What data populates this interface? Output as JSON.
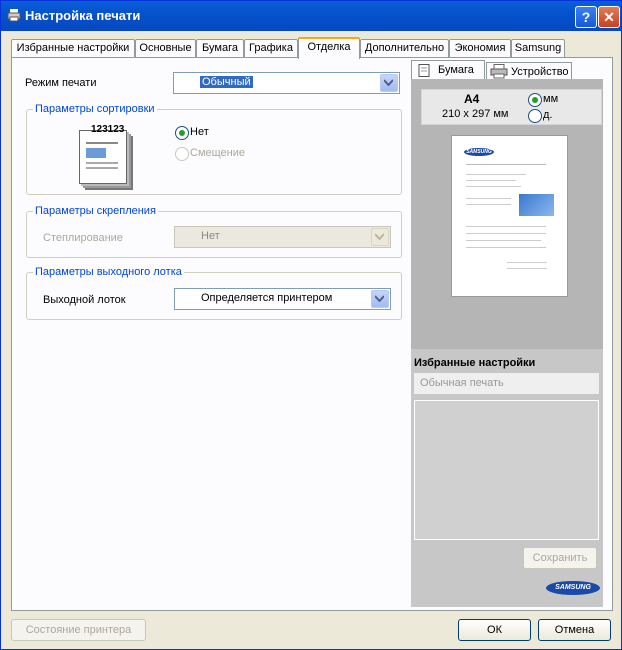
{
  "window": {
    "title": "Настройка печати",
    "help": "?",
    "close": "✕"
  },
  "tabs": [
    "Избранные настройки",
    "Основные",
    "Бумага",
    "Графика",
    "Отделка",
    "Дополнительно",
    "Экономия",
    "Samsung"
  ],
  "print_mode": {
    "label": "Режим печати",
    "value": "Обычный"
  },
  "collate": {
    "title": "Параметры сортировки",
    "sample_digits": "123123",
    "option_none": "Нет",
    "option_offset": "Смещение"
  },
  "staple": {
    "title": "Параметры скрепления",
    "label": "Степлирование",
    "value": "Нет"
  },
  "output": {
    "title": "Параметры выходного лотка",
    "label": "Выходной лоток",
    "value": "Определяется принтером"
  },
  "side_tabs": {
    "paper": "Бумага",
    "device": "Устройство"
  },
  "paper_info": {
    "size": "A4",
    "dims": "210 x 297 мм",
    "unit_mm": "мм",
    "unit_in": "д."
  },
  "preview_logo": "SAMSUNG",
  "favorites": {
    "title": "Избранные настройки",
    "selected": "Обычная печать",
    "save": "Сохранить"
  },
  "brand_logo": "SAMSUNG",
  "footer": {
    "printer_status": "Состояние принтера",
    "ok": "ОК",
    "cancel": "Отмена"
  }
}
